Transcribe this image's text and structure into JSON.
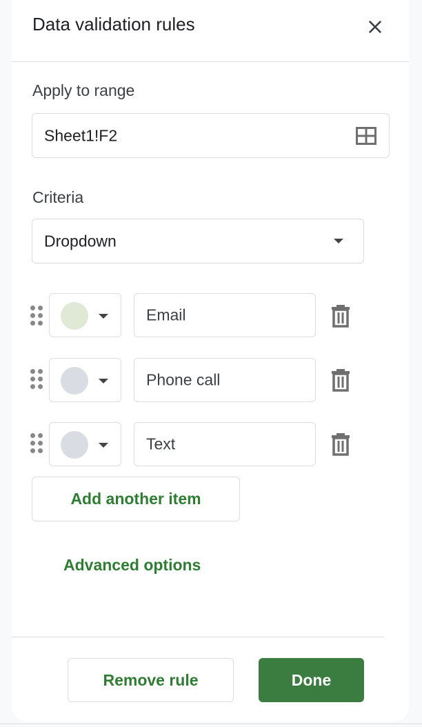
{
  "dialog": {
    "title": "Data validation rules",
    "close_icon": "close-icon"
  },
  "range": {
    "label": "Apply to range",
    "value": "Sheet1!F2",
    "icon": "grid-select-icon"
  },
  "criteria": {
    "label": "Criteria",
    "selected": "Dropdown"
  },
  "items": [
    {
      "value": "Email",
      "color": "#dfe9d6"
    },
    {
      "value": "Phone call",
      "color": "#dadce3"
    },
    {
      "value": "Text",
      "color": "#dadce3"
    }
  ],
  "actions": {
    "add_item": "Add another item",
    "advanced": "Advanced options",
    "remove_rule": "Remove rule",
    "done": "Done"
  },
  "colors": {
    "accent": "#2e7d32",
    "done_bg": "#3b7d40"
  }
}
